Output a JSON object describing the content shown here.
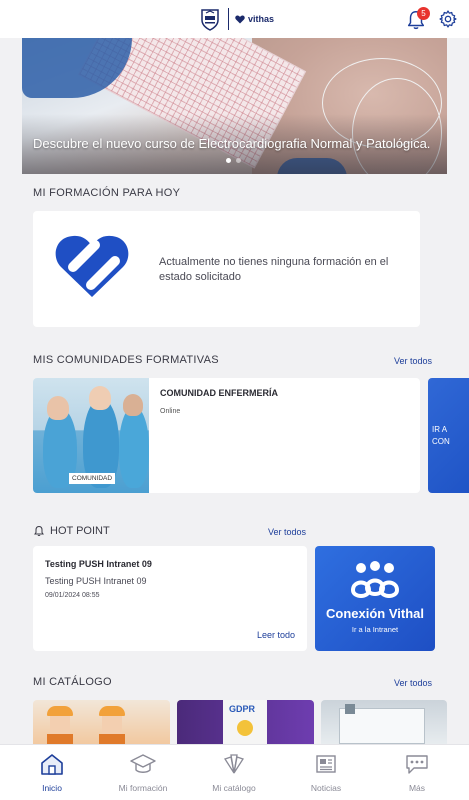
{
  "header": {
    "brand": "vithas",
    "notifications_count": "5"
  },
  "banner": {
    "text": "Descubre el nuevo curso de Electrocardiografia Normal y Patológica.",
    "active_slide": 1,
    "slide_count": 2
  },
  "formation": {
    "title": "MI FORMACIÓN PARA HOY",
    "empty_message": "Actualmente no tienes ninguna formación en el estado solicitado"
  },
  "communities": {
    "title": "MIS COMUNIDADES FORMATIVAS",
    "see_all": "Ver todos",
    "items": [
      {
        "name": "COMUNIDAD ENFERMERÍA",
        "mode": "Online",
        "tag": "COMUNIDAD"
      }
    ],
    "peek_text": "IR A\nCON"
  },
  "hot_point": {
    "title": "HOT POINT",
    "see_all": "Ver todos",
    "item": {
      "title": "Testing PUSH Intranet 09",
      "subtitle": "Testing PUSH Intranet 09",
      "date": "09/01/2024 08:55",
      "read_all": "Leer todo"
    },
    "promo": {
      "name": "Conexión Vithal",
      "subtitle": "Ir a la Intranet"
    }
  },
  "catalog": {
    "title": "MI CATÁLOGO",
    "see_all": "Ver todos",
    "gdpr_label": "GDPR"
  },
  "tabbar": {
    "tabs": [
      {
        "label": "Inicio",
        "icon": "home-icon",
        "active": true
      },
      {
        "label": "Mi formación",
        "icon": "graduation-cap-icon",
        "active": false
      },
      {
        "label": "Mi catálogo",
        "icon": "catalog-fan-icon",
        "active": false
      },
      {
        "label": "Noticias",
        "icon": "newspaper-icon",
        "active": false
      },
      {
        "label": "Más",
        "icon": "chat-more-icon",
        "active": false
      }
    ]
  },
  "colors": {
    "primary": "#1d3e9a",
    "brand_blue": "#2f6fe0",
    "badge_red": "#e8332e",
    "background": "#f1f1f3"
  }
}
